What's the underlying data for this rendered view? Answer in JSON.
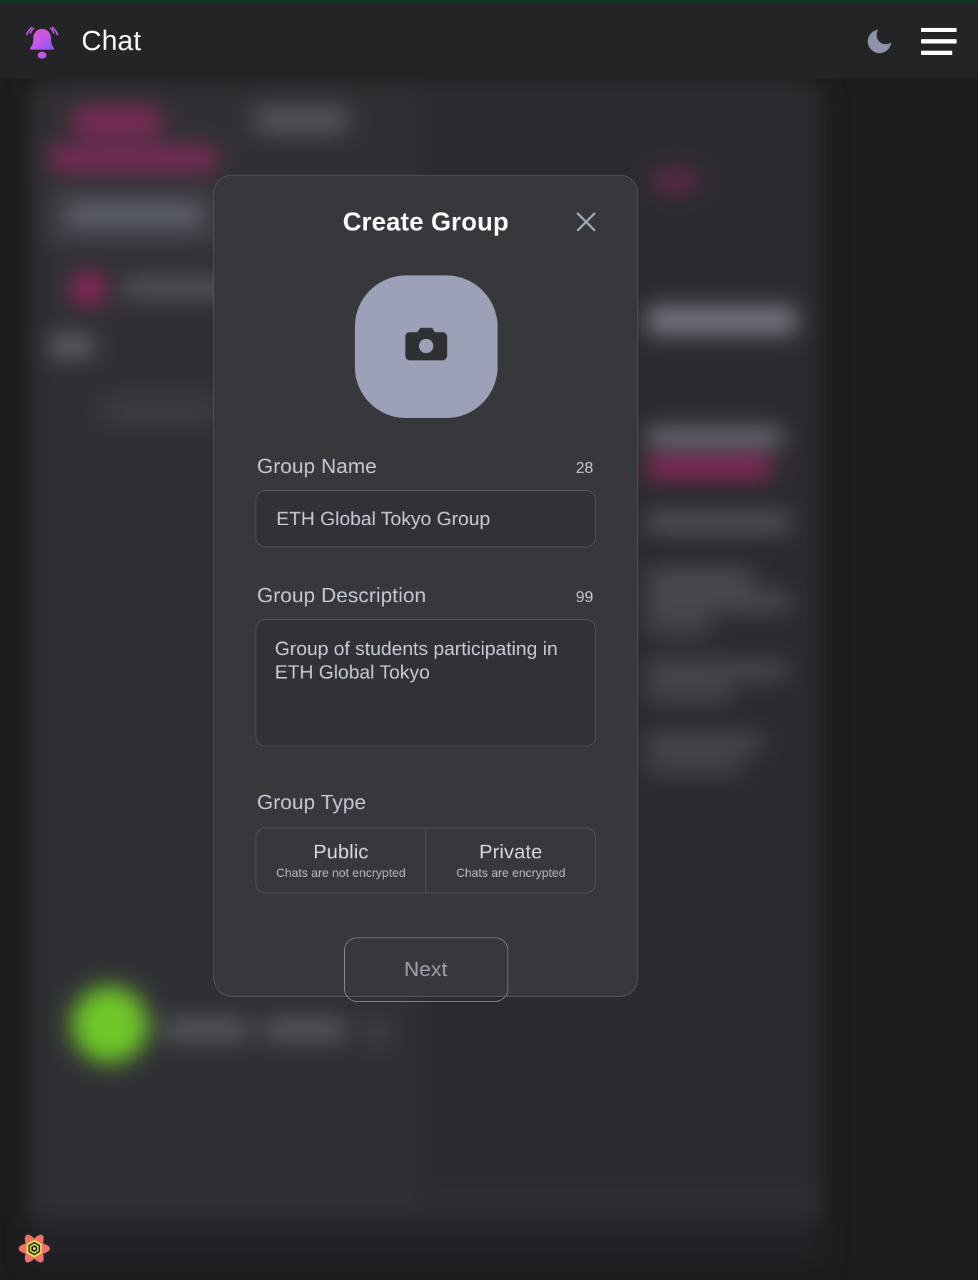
{
  "header": {
    "title": "Chat",
    "bell_icon": "bell-notification-icon",
    "theme_toggle_icon": "moon-icon",
    "menu_icon": "hamburger-menu-icon"
  },
  "modal": {
    "title": "Create Group",
    "close_icon": "close-x-icon",
    "avatar": {
      "icon": "camera-icon",
      "bg_color": "#9ca1b8"
    },
    "fields": {
      "group_name": {
        "label": "Group Name",
        "counter": "28",
        "value": "ETH Global Tokyo Group",
        "placeholder": "Group Name"
      },
      "group_description": {
        "label": "Group Description",
        "counter": "99",
        "value": "Group of students participating in ETH Global Tokyo",
        "placeholder": "Group Description"
      },
      "group_type": {
        "label": "Group Type",
        "options": [
          {
            "title": "Public",
            "subtitle": "Chats are not encrypted"
          },
          {
            "title": "Private",
            "subtitle": "Chats are encrypted"
          }
        ]
      }
    },
    "next_button": "Next"
  },
  "corner": {
    "badge_icon": "atom-flower-badge-icon"
  },
  "colors": {
    "page_bg": "#1c1c1e",
    "header_bg": "#242426",
    "modal_bg": "#38383c",
    "modal_border": "#5a5c66",
    "input_bg": "#313136",
    "accent_pink": "#c4267a",
    "accent_purple": "#a855f7",
    "text_primary": "#ffffff",
    "text_secondary": "#c6cad8",
    "muted": "#9ea2ae",
    "top_strip": "#0f3320",
    "online_green": "#6fc72a"
  }
}
